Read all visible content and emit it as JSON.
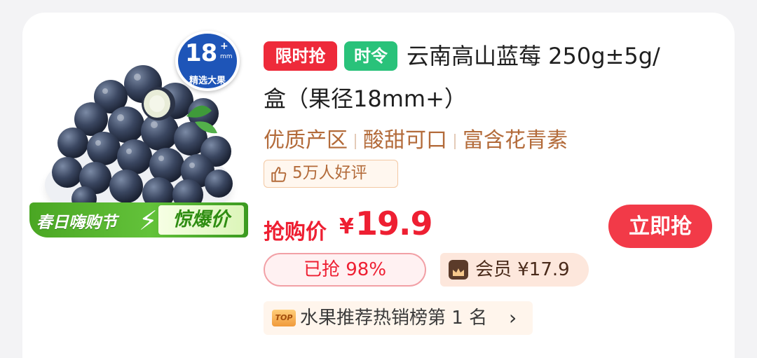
{
  "product": {
    "badge_size": "18",
    "badge_plus": "+",
    "badge_unit": "mm",
    "badge_sub": "精选大果",
    "promo_left": "春日嗨购节",
    "promo_right": "惊爆价",
    "tag_limited": "限时抢",
    "tag_season": "时令",
    "title_line1": "云南高山蓝莓 250g±5g/",
    "title_line2": "盒（果径18mm+）",
    "features": [
      "优质产区",
      "酸甜可口",
      "富含花青素"
    ],
    "reviews": "5万人好评"
  },
  "price": {
    "label": "抢购价",
    "currency": "¥",
    "value": "19.9",
    "buy_button": "立即抢",
    "sold": "已抢 98%",
    "member": "会员 ¥17.9"
  },
  "rank": {
    "icon": "TOP",
    "text": "水果推荐热销榜第 1 名",
    "chevron": "›"
  },
  "colors": {
    "accent_red": "#ee1f32",
    "tag_green": "#29c27a",
    "feature_brown": "#b36b3a",
    "promo_green": "#4aa623"
  }
}
